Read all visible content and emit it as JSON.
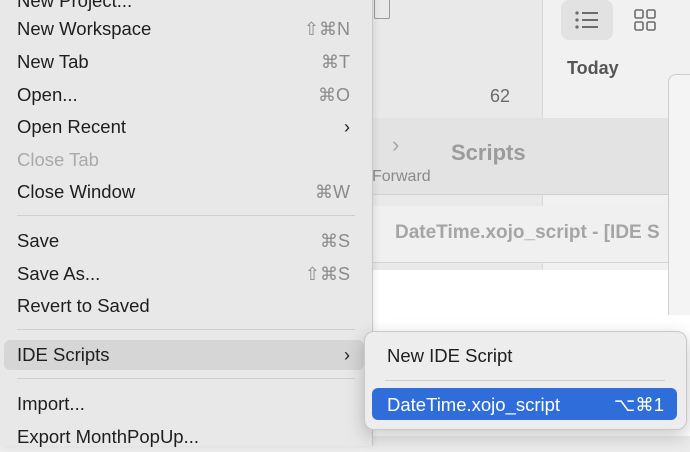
{
  "background": {
    "today_label": "Today",
    "count": "62",
    "forward_chevron": "›",
    "forward_label": "Forward",
    "scripts_title": "Scripts",
    "document_title": "DateTime.xojo_script - [IDE S",
    "toolbar_list_icon": "list-icon",
    "toolbar_grid_icon": "grid-icon"
  },
  "menu": {
    "items": [
      {
        "label": "New Project...",
        "shortcut": ""
      },
      {
        "label": "New Workspace",
        "shortcut": "⇧⌘N"
      },
      {
        "label": "New Tab",
        "shortcut": "⌘T"
      },
      {
        "label": "Open...",
        "shortcut": "⌘O"
      },
      {
        "label": "Open Recent",
        "arrow": "›"
      },
      {
        "label": "Close Tab",
        "shortcut": ""
      },
      {
        "label": "Close Window",
        "shortcut": "⌘W"
      },
      {
        "label": "Save",
        "shortcut": "⌘S"
      },
      {
        "label": "Save As...",
        "shortcut": "⇧⌘S"
      },
      {
        "label": "Revert to Saved",
        "shortcut": ""
      },
      {
        "label": "IDE Scripts",
        "arrow": "›"
      },
      {
        "label": "Import...",
        "shortcut": ""
      },
      {
        "label": "Export MonthPopUp...",
        "shortcut": ""
      }
    ]
  },
  "submenu": {
    "items": [
      {
        "label": "New IDE Script",
        "shortcut": ""
      },
      {
        "label": "DateTime.xojo_script",
        "shortcut": "⌥⌘1"
      }
    ]
  },
  "colors": {
    "selection": "#2f6ddb",
    "menu_bg": "#e8e8e8",
    "disabled_text": "#a9a9a9"
  }
}
